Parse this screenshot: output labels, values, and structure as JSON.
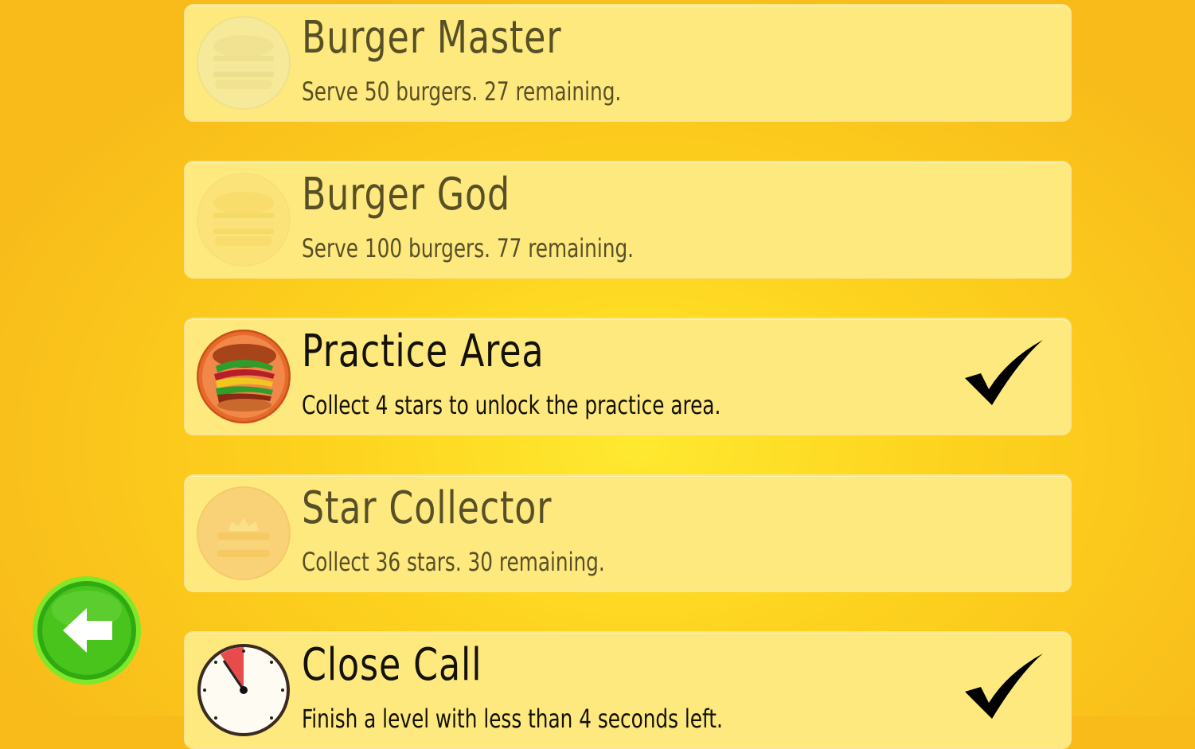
{
  "achievements": [
    {
      "title": "Burger Master",
      "description": "Serve 50 burgers. 27 remaining.",
      "unlocked": false,
      "badge_icon": "burger-icon"
    },
    {
      "title": "Burger God",
      "description": "Serve 100 burgers. 77 remaining.",
      "unlocked": false,
      "badge_icon": "burger-icon"
    },
    {
      "title": "Practice Area",
      "description": "Collect 4 stars to unlock the practice area.",
      "unlocked": true,
      "badge_icon": "burger-stack-icon"
    },
    {
      "title": "Star Collector",
      "description": "Collect 36 stars. 30 remaining.",
      "unlocked": false,
      "badge_icon": "star-stack-icon"
    },
    {
      "title": "Close Call",
      "description": "Finish a level with less than 4 seconds left.",
      "unlocked": true,
      "badge_icon": "stopwatch-icon"
    }
  ],
  "back_button": {
    "icon": "back-arrow-icon"
  },
  "colors": {
    "background": "#fcc51c",
    "card": "#fde97e",
    "back_button": "#3bbf18",
    "check": "#000000"
  }
}
